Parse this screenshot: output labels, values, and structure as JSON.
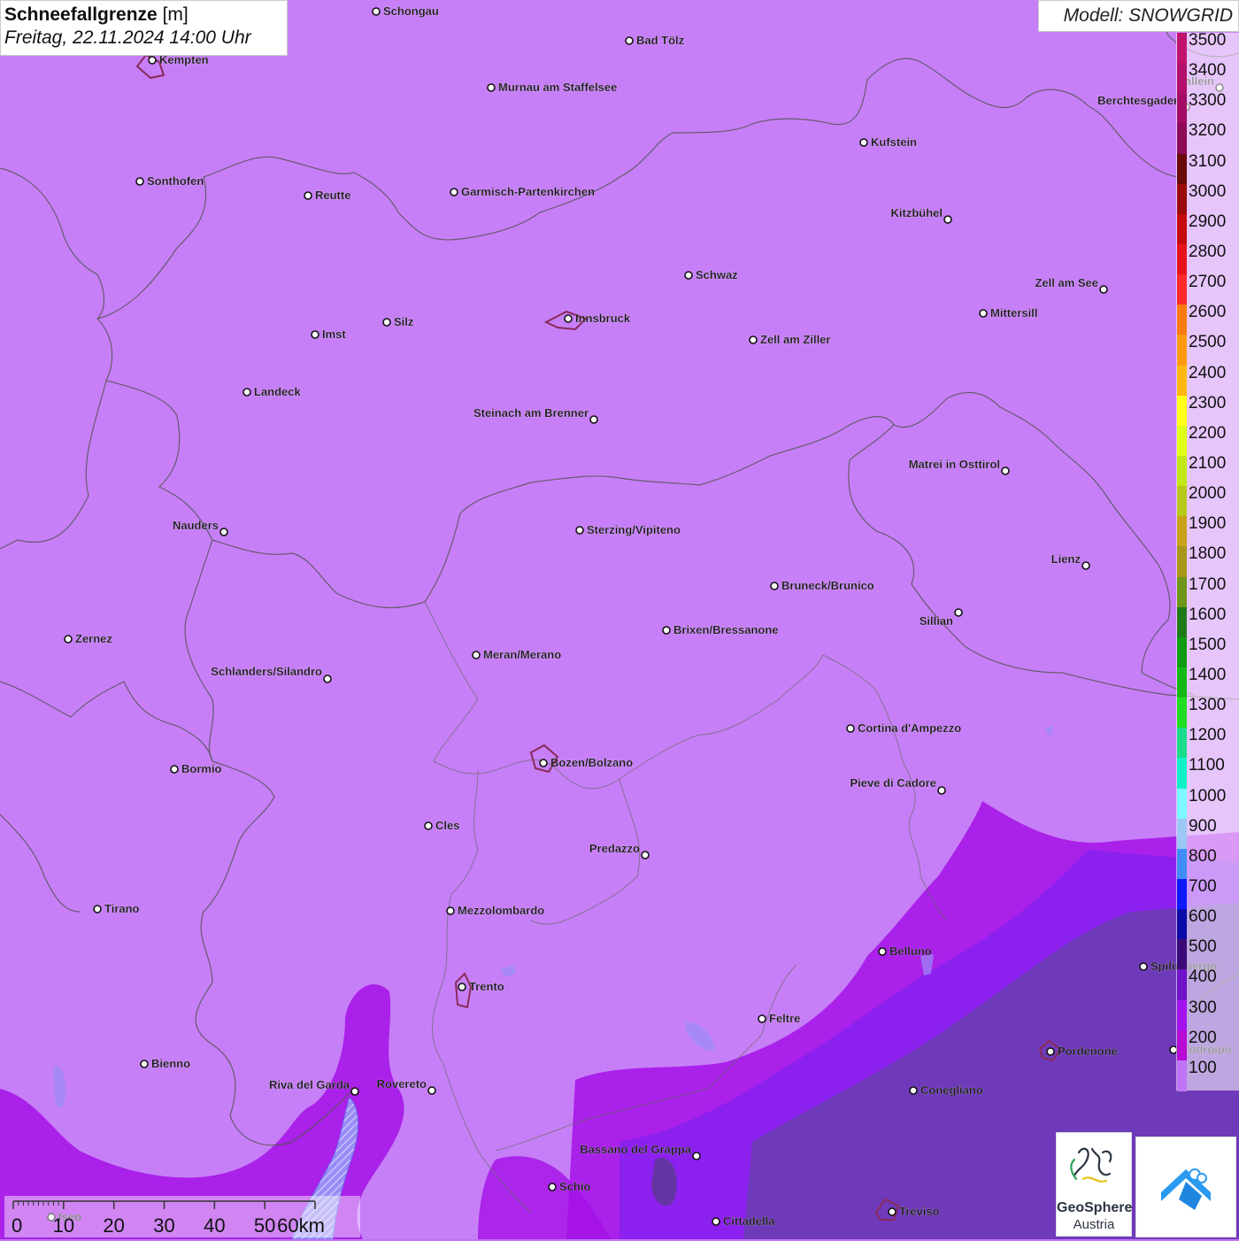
{
  "title": {
    "parameter": "Schneefallgrenze",
    "unit": "[m]",
    "datetime": "Freitag, 22.11.2024 14:00 Uhr"
  },
  "model": "Modell: SNOWGRID",
  "legend": {
    "labels": [
      "3500",
      "3400",
      "3300",
      "3200",
      "3100",
      "3000",
      "2900",
      "2800",
      "2700",
      "2600",
      "2500",
      "2400",
      "2300",
      "2200",
      "2100",
      "2000",
      "1900",
      "1800",
      "1700",
      "1600",
      "1500",
      "1400",
      "1300",
      "1200",
      "1100",
      "1000",
      "900",
      "800",
      "700",
      "600",
      "500",
      "400",
      "300",
      "200",
      "100"
    ],
    "colors": [
      "#c0136e",
      "#b40f6a",
      "#a50d64",
      "#8c0a56",
      "#6a0a0a",
      "#9b0a0a",
      "#c40a0a",
      "#e6141a",
      "#ff2a2a",
      "#ff7a10",
      "#ff9a10",
      "#ffb812",
      "#ffff1a",
      "#dfff1a",
      "#c2e81a",
      "#b7c81a",
      "#c8a21a",
      "#a8961a",
      "#6f961a",
      "#1f7a1a",
      "#0f9a10",
      "#16b816",
      "#22dc22",
      "#1adc8a",
      "#12f0c8",
      "#7ff7ff",
      "#9cc8f5",
      "#3f8ef5",
      "#0d1aff",
      "#0a0aa6",
      "#3a0a78",
      "#6f12c8",
      "#a412f0",
      "#b80ad4",
      "#c174f6"
    ]
  },
  "cities": [
    {
      "name": "Schongau",
      "dot": [
        425,
        13
      ]
    },
    {
      "name": "Bad Tölz",
      "dot": [
        711,
        46
      ]
    },
    {
      "name": "Kempten",
      "dot": [
        172,
        68
      ]
    },
    {
      "name": "Murnau am Staffelsee",
      "dot": [
        555,
        99
      ]
    },
    {
      "name": "Hallein",
      "dot": [
        1378,
        99
      ]
    },
    {
      "name": "Berchtesgaden",
      "dot": [
        1340,
        121
      ]
    },
    {
      "name": "Kufstein",
      "dot": [
        976,
        161
      ]
    },
    {
      "name": "Sonthofen",
      "dot": [
        158,
        205
      ]
    },
    {
      "name": "Reutte",
      "dot": [
        348,
        221
      ]
    },
    {
      "name": "Garmisch-Partenkirchen",
      "dot": [
        513,
        217
      ]
    },
    {
      "name": "Kitzbühel",
      "dot": [
        1071,
        248
      ]
    },
    {
      "name": "Schwaz",
      "dot": [
        778,
        311
      ]
    },
    {
      "name": "Zell am See",
      "dot": [
        1247,
        327
      ]
    },
    {
      "name": "Mittersill",
      "dot": [
        1111,
        354
      ]
    },
    {
      "name": "Innsbruck",
      "dot": [
        642,
        360
      ]
    },
    {
      "name": "Silz",
      "dot": [
        437,
        364
      ]
    },
    {
      "name": "Imst",
      "dot": [
        356,
        378
      ]
    },
    {
      "name": "Zell am Ziller",
      "dot": [
        851,
        384
      ]
    },
    {
      "name": "Landeck",
      "dot": [
        279,
        443
      ]
    },
    {
      "name": "Steinach am Brenner",
      "dot": [
        671,
        474
      ]
    },
    {
      "name": "Matrei in Osttirol",
      "dot": [
        1136,
        532
      ]
    },
    {
      "name": "Nauders",
      "dot": [
        253,
        601
      ]
    },
    {
      "name": "Sterzing/Vipiteno",
      "dot": [
        655,
        599
      ]
    },
    {
      "name": "Lienz",
      "dot": [
        1227,
        639
      ]
    },
    {
      "name": "Bruneck/Brunico",
      "dot": [
        875,
        662
      ]
    },
    {
      "name": "Sillian",
      "dot": [
        1083,
        692
      ]
    },
    {
      "name": "Brixen/Bressanone",
      "dot": [
        753,
        712
      ]
    },
    {
      "name": "Zernez",
      "dot": [
        77,
        722
      ]
    },
    {
      "name": "Meran/Merano",
      "dot": [
        538,
        740
      ]
    },
    {
      "name": "Schlanders/Silandro",
      "dot": [
        370,
        767
      ]
    },
    {
      "name": "Cortina d'Ampezzo",
      "dot": [
        961,
        823
      ]
    },
    {
      "name": "Bozen/Bolzano",
      "dot": [
        614,
        862
      ]
    },
    {
      "name": "Bormio",
      "dot": [
        197,
        869
      ]
    },
    {
      "name": "Pieve di Cadore",
      "dot": [
        1064,
        893
      ]
    },
    {
      "name": "Cles",
      "dot": [
        484,
        933
      ]
    },
    {
      "name": "Predazzo",
      "dot": [
        729,
        966
      ]
    },
    {
      "name": "Tirano",
      "dot": [
        110,
        1027
      ]
    },
    {
      "name": "Mezzolombardo",
      "dot": [
        509,
        1029
      ]
    },
    {
      "name": "Belluno",
      "dot": [
        997,
        1075
      ]
    },
    {
      "name": "Spilimbergo",
      "dot": [
        1292,
        1092
      ]
    },
    {
      "name": "Trento",
      "dot": [
        522,
        1115
      ]
    },
    {
      "name": "Feltre",
      "dot": [
        861,
        1151
      ]
    },
    {
      "name": "Pordenone",
      "dot": [
        1187,
        1188
      ]
    },
    {
      "name": "Codroipo",
      "dot": [
        1326,
        1186
      ]
    },
    {
      "name": "Bienno",
      "dot": [
        163,
        1202
      ]
    },
    {
      "name": "Riva del Garda",
      "dot": [
        401,
        1233
      ]
    },
    {
      "name": "Rovereto",
      "dot": [
        488,
        1232
      ]
    },
    {
      "name": "Conegliano",
      "dot": [
        1032,
        1232
      ]
    },
    {
      "name": "Bassano del Grappa",
      "dot": [
        787,
        1306
      ]
    },
    {
      "name": "Schio",
      "dot": [
        624,
        1341
      ]
    },
    {
      "name": "Treviso",
      "dot": [
        1008,
        1369
      ]
    },
    {
      "name": "Cittadella",
      "dot": [
        809,
        1380
      ]
    },
    {
      "name": "Iseo",
      "dot": [
        58,
        1375
      ]
    }
  ],
  "scale_bar": {
    "labels": [
      "0",
      "10",
      "20",
      "30",
      "40",
      "50",
      "60km"
    ]
  },
  "logos": {
    "geosphere_name": "GeoSphere",
    "geosphere_sub": "Austria"
  }
}
